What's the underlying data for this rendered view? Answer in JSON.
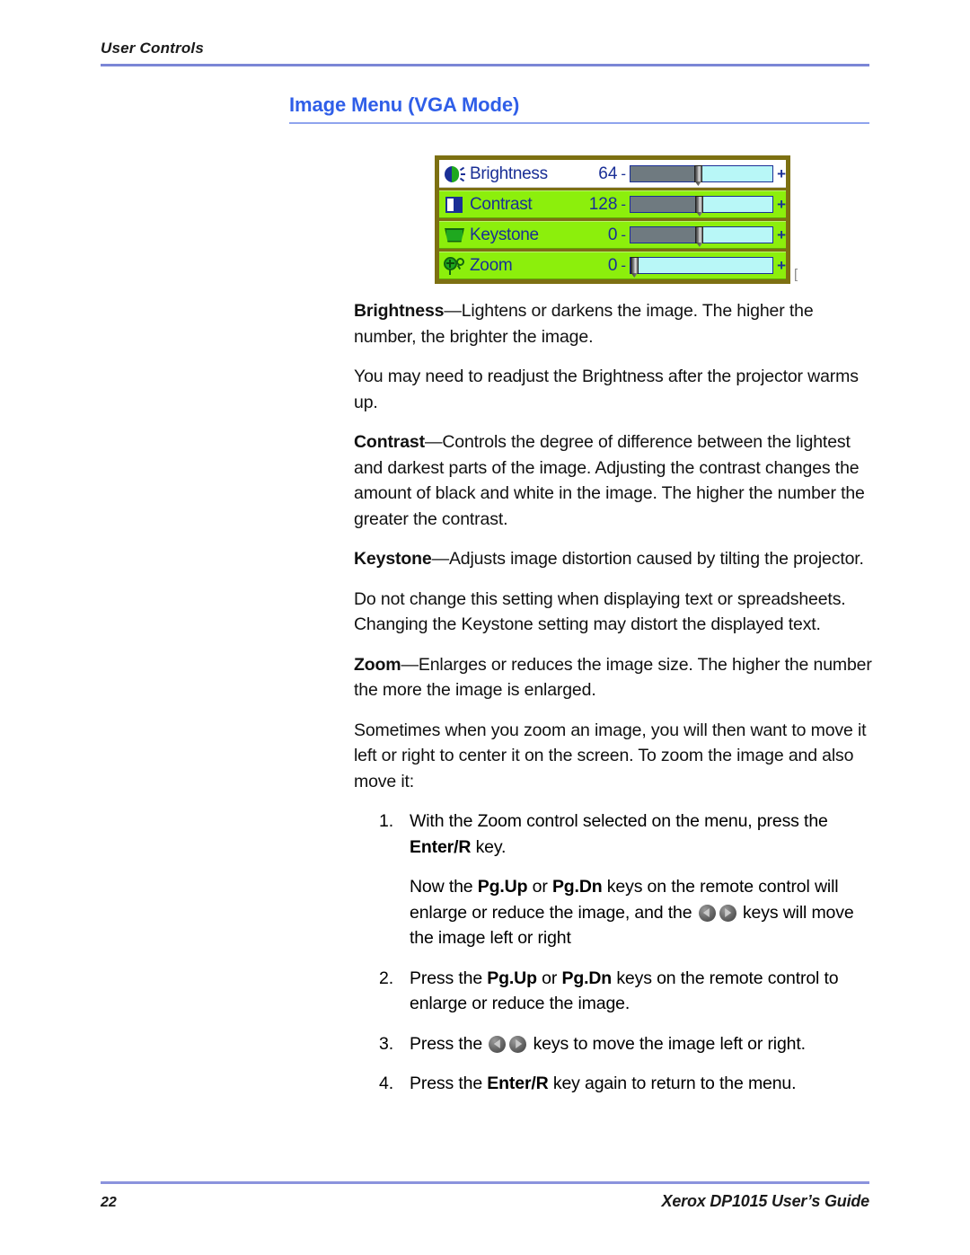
{
  "header": {
    "running_head": "User Controls"
  },
  "section": {
    "heading": "Image Menu (VGA Mode)"
  },
  "osd_menu": {
    "rows": [
      {
        "icon": "brightness-icon",
        "label": "Brightness",
        "value": "64",
        "minus": "-",
        "plus": "+",
        "fill_percent": 48,
        "thumb_percent": 48,
        "selected": true
      },
      {
        "icon": "contrast-icon",
        "label": "Contrast",
        "value": "128",
        "minus": "-",
        "plus": "+",
        "fill_percent": 49,
        "thumb_percent": 49,
        "selected": false
      },
      {
        "icon": "keystone-icon",
        "label": "Keystone",
        "value": "0",
        "minus": "-",
        "plus": "+",
        "fill_percent": 49,
        "thumb_percent": 49,
        "selected": false
      },
      {
        "icon": "zoom-icon",
        "label": "Zoom",
        "value": "0",
        "minus": "-",
        "plus": "+",
        "fill_percent": 0,
        "thumb_percent": 3,
        "selected": false
      }
    ],
    "stray_mark": "["
  },
  "body": {
    "p_brightness_term": "Brightness",
    "p_brightness_rest": "—Lightens or darkens the image. The higher the number, the brighter the image.",
    "p_brightness_note": "You may need to readjust the Brightness after the projector warms up.",
    "p_contrast_term": "Contrast",
    "p_contrast_rest": "—Controls the degree of difference between the lightest and darkest parts of the image. Adjusting the contrast changes the amount of black and white in the image. The higher the number the greater the contrast.",
    "p_keystone_term": "Keystone",
    "p_keystone_rest": "—Adjusts image distortion caused by tilting the projector.",
    "p_keystone_note": "Do not change this setting when displaying text or spreadsheets. Changing the Keystone setting may distort the displayed text.",
    "p_zoom_term": "Zoom",
    "p_zoom_rest": "—Enlarges or reduces the image size. The higher the number the more the image is enlarged.",
    "p_zoom_intro": "Sometimes when you zoom an image, you will then want to move it left or right to center it on the screen. To zoom the image and also move it:"
  },
  "steps": {
    "step1_a": "With the Zoom control selected on the menu, press the ",
    "step1_key": "Enter/R",
    "step1_b": " key.",
    "step1_sub_a": "Now the ",
    "step1_sub_pgup": "Pg.Up",
    "step1_sub_b": " or ",
    "step1_sub_pgdn": "Pg.Dn",
    "step1_sub_c": " keys on the remote control will enlarge or reduce the image, and the ",
    "step1_sub_d": " keys will move the image left or right",
    "step2_a": "Press the ",
    "step2_pgup": "Pg.Up",
    "step2_b": " or ",
    "step2_pgdn": "Pg.Dn",
    "step2_c": " keys on the remote control to enlarge or reduce the image.",
    "step3_a": "Press the ",
    "step3_b": " keys to move the image left or right.",
    "step4_a": "Press the ",
    "step4_key": "Enter/R",
    "step4_b": " key again to return to the menu."
  },
  "footer": {
    "page_number": "22",
    "guide_title": "Xerox DP1015 User’s Guide"
  },
  "colors": {
    "heading_blue": "#2f5ee8",
    "rule_purple": "#7b86d6",
    "osd_green": "#8cef0c",
    "osd_border": "#7d7012",
    "osd_text_blue": "#1a2f96",
    "slider_track": "#b8f7f7",
    "slider_fill": "#6f7a80"
  }
}
